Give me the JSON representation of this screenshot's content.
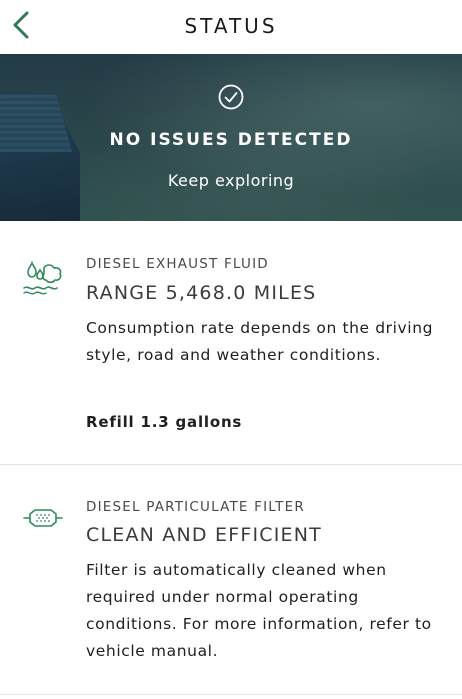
{
  "header": {
    "title": "STATUS",
    "back_icon": "chevron-left-icon",
    "accent_color": "#2f7a54"
  },
  "hero": {
    "icon": "check-circle-icon",
    "title": "NO ISSUES DETECTED",
    "subtitle": "Keep exploring"
  },
  "sections": [
    {
      "icon": "diesel-exhaust-fluid-icon",
      "label": "DIESEL EXHAUST FLUID",
      "headline": "RANGE 5,468.0 MILES",
      "description": "Consumption rate depends on the driving style, road and weather conditions.",
      "action": "Refill 1.3 gallons"
    },
    {
      "icon": "particulate-filter-icon",
      "label": "DIESEL PARTICULATE FILTER",
      "headline": "CLEAN AND EFFICIENT",
      "description": "Filter is automatically cleaned when required under normal operating conditions. For more information, refer to vehicle manual."
    }
  ],
  "colors": {
    "icon_green": "#2f8a5c",
    "hero_dark": "#1f3a45"
  }
}
